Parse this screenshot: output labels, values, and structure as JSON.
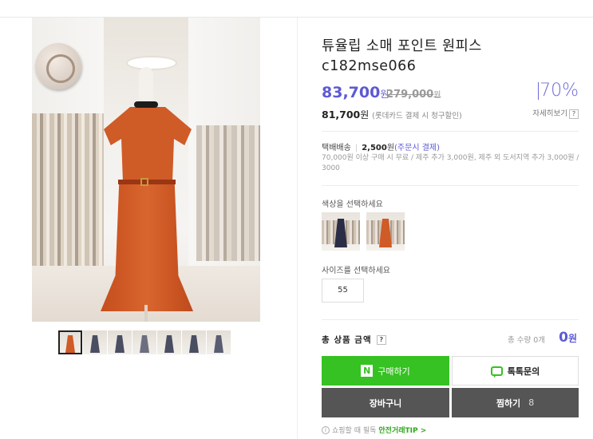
{
  "product": {
    "title": "튜율립 소매 포인트 원피스c182mse066",
    "price": "83,700",
    "price_unit": "원",
    "original_price": "279,000",
    "original_unit": "원",
    "discount": "70%",
    "card_price": "81,700",
    "card_price_unit": "원",
    "card_note": "(롯데카드 결제 시 청구할인)",
    "detail_link": "자세히보기",
    "help_mark": "?"
  },
  "shipping": {
    "label": "택배배송",
    "fee": "2,500",
    "fee_unit": "원",
    "fee_note": "(주문시 결제)",
    "note": "70,000원 이상 구매 시 무료 / 제주 추가 3,000원, 제주 외 도서지역 추가 3,000원 / 3000"
  },
  "options": {
    "color_label": "색상을 선택하세요",
    "colors": [
      {
        "name": "navy",
        "swatch": "#2a2d45"
      },
      {
        "name": "orange",
        "swatch": "#cf5b27"
      }
    ],
    "size_label": "사이즈를 선택하세요",
    "sizes": [
      "55"
    ]
  },
  "summary": {
    "total_label": "총 상품 금액",
    "total_qty": "총 수량 0개",
    "total_value": "0",
    "total_unit": "원"
  },
  "buttons": {
    "buy_icon": "N",
    "buy": "구매하기",
    "talk": "톡톡문의",
    "cart": "장바구니",
    "wish": "찜하기",
    "wish_count": "8"
  },
  "tip": {
    "prefix": "쇼핑할 때 필독",
    "link": "안전거래TIP >"
  },
  "thumbnails": [
    {
      "dress": "#cf5b27"
    },
    {
      "dress": "#4a4e63"
    },
    {
      "dress": "#4a4e63"
    },
    {
      "dress": "#6b6f80"
    },
    {
      "dress": "#4a4e63"
    },
    {
      "dress": "#4a4e63"
    },
    {
      "dress": "#5a5e72"
    }
  ],
  "colors": {
    "accent": "#5d5ad3",
    "npay_green": "#35c222",
    "dark_button": "#555555"
  }
}
